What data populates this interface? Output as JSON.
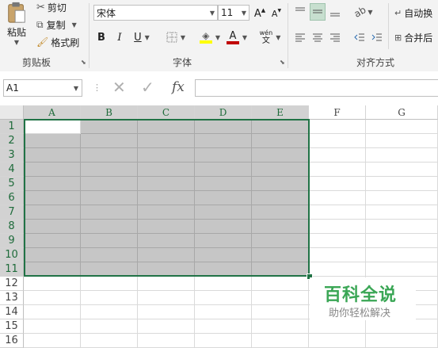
{
  "clipboard": {
    "paste": "粘贴",
    "cut": "剪切",
    "copy": "复制",
    "format_painter": "格式刷",
    "group": "剪贴板"
  },
  "font": {
    "name": "宋体",
    "size": "11",
    "bold": "B",
    "italic": "I",
    "underline": "U",
    "group": "字体",
    "wen": "wén",
    "wen_char": "文",
    "grow": "A",
    "shrink": "A"
  },
  "alignment": {
    "wrap": "自动换",
    "merge": "合并后",
    "group": "对齐方式"
  },
  "namebox": "A1",
  "fx": "fx",
  "columns": [
    "A",
    "B",
    "C",
    "D",
    "E",
    "F",
    "G"
  ],
  "rows": [
    "1",
    "2",
    "3",
    "4",
    "5",
    "6",
    "7",
    "8",
    "9",
    "10",
    "11",
    "12",
    "13",
    "14",
    "15",
    "16"
  ],
  "watermark": {
    "title": "百科全说",
    "subtitle": "助你轻松解决"
  },
  "colors": {
    "select_fill": "#c6c6c6",
    "select_border": "#217346",
    "font_color": "#c00000",
    "highlight": "#ffff00"
  }
}
